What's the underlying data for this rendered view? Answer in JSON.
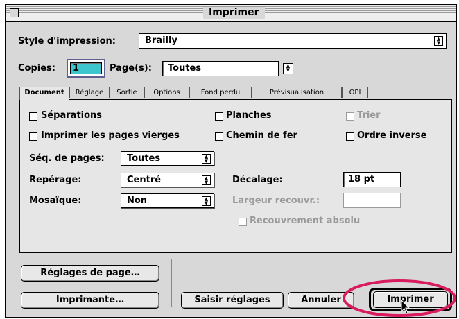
{
  "window": {
    "title": "Imprimer"
  },
  "print_style": {
    "label": "Style d'impression:",
    "value": "Brailly"
  },
  "copies": {
    "label": "Copies:",
    "value": "1"
  },
  "pages": {
    "label": "Page(s):",
    "value": "Toutes"
  },
  "tabs": [
    {
      "label": "Document",
      "active": true
    },
    {
      "label": "Réglage"
    },
    {
      "label": "Sortie"
    },
    {
      "label": "Options"
    },
    {
      "label": "Fond perdu"
    },
    {
      "label": "Prévisualisation"
    },
    {
      "label": "OPI"
    }
  ],
  "document": {
    "separations": {
      "label": "Séparations",
      "checked": false
    },
    "planches": {
      "label": "Planches",
      "checked": false
    },
    "trier": {
      "label": "Trier",
      "checked": false,
      "enabled": false
    },
    "blank_pages": {
      "label": "Imprimer les pages vierges",
      "checked": false
    },
    "chemin_de_fer": {
      "label": "Chemin de fer",
      "checked": false
    },
    "ordre_inverse": {
      "label": "Ordre inverse",
      "checked": false
    },
    "page_sequence": {
      "label": "Séq. de pages:",
      "value": "Toutes"
    },
    "registration": {
      "label": "Repérage:",
      "value": "Centré"
    },
    "offset": {
      "label": "Décalage:",
      "value": "18 pt"
    },
    "tiling": {
      "label": "Mosaïque:",
      "value": "Non"
    },
    "overlap": {
      "label": "Largeur recouvr.:",
      "value": ""
    },
    "absolute_overlap": {
      "label": "Recouvrement absolu",
      "checked": false,
      "enabled": false
    }
  },
  "buttons": {
    "page_setup": "Réglages de page…",
    "printer": "Imprimante…",
    "capture_settings": "Saisir réglages",
    "cancel": "Annuler",
    "print": "Imprimer"
  },
  "colors": {
    "window_bg": "#d8d8d8",
    "copies_highlight": "#3ec6cf",
    "annotation_circle": "#d81b5e"
  }
}
